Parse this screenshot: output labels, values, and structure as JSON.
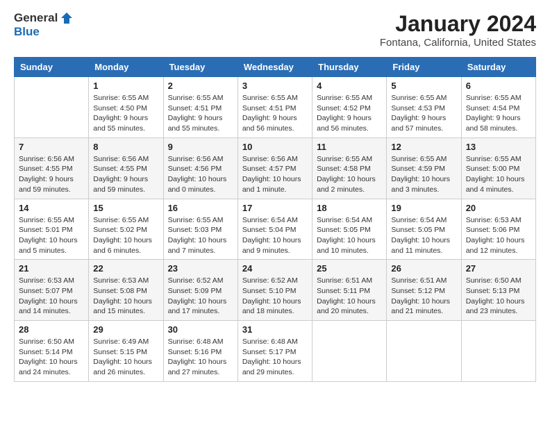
{
  "header": {
    "logo_general": "General",
    "logo_blue": "Blue",
    "title": "January 2024",
    "subtitle": "Fontana, California, United States"
  },
  "days_of_week": [
    "Sunday",
    "Monday",
    "Tuesday",
    "Wednesday",
    "Thursday",
    "Friday",
    "Saturday"
  ],
  "weeks": [
    [
      {
        "day": "",
        "info": ""
      },
      {
        "day": "1",
        "info": "Sunrise: 6:55 AM\nSunset: 4:50 PM\nDaylight: 9 hours\nand 55 minutes."
      },
      {
        "day": "2",
        "info": "Sunrise: 6:55 AM\nSunset: 4:51 PM\nDaylight: 9 hours\nand 55 minutes."
      },
      {
        "day": "3",
        "info": "Sunrise: 6:55 AM\nSunset: 4:51 PM\nDaylight: 9 hours\nand 56 minutes."
      },
      {
        "day": "4",
        "info": "Sunrise: 6:55 AM\nSunset: 4:52 PM\nDaylight: 9 hours\nand 56 minutes."
      },
      {
        "day": "5",
        "info": "Sunrise: 6:55 AM\nSunset: 4:53 PM\nDaylight: 9 hours\nand 57 minutes."
      },
      {
        "day": "6",
        "info": "Sunrise: 6:55 AM\nSunset: 4:54 PM\nDaylight: 9 hours\nand 58 minutes."
      }
    ],
    [
      {
        "day": "7",
        "info": "Sunrise: 6:56 AM\nSunset: 4:55 PM\nDaylight: 9 hours\nand 59 minutes."
      },
      {
        "day": "8",
        "info": "Sunrise: 6:56 AM\nSunset: 4:55 PM\nDaylight: 9 hours\nand 59 minutes."
      },
      {
        "day": "9",
        "info": "Sunrise: 6:56 AM\nSunset: 4:56 PM\nDaylight: 10 hours\nand 0 minutes."
      },
      {
        "day": "10",
        "info": "Sunrise: 6:56 AM\nSunset: 4:57 PM\nDaylight: 10 hours\nand 1 minute."
      },
      {
        "day": "11",
        "info": "Sunrise: 6:55 AM\nSunset: 4:58 PM\nDaylight: 10 hours\nand 2 minutes."
      },
      {
        "day": "12",
        "info": "Sunrise: 6:55 AM\nSunset: 4:59 PM\nDaylight: 10 hours\nand 3 minutes."
      },
      {
        "day": "13",
        "info": "Sunrise: 6:55 AM\nSunset: 5:00 PM\nDaylight: 10 hours\nand 4 minutes."
      }
    ],
    [
      {
        "day": "14",
        "info": "Sunrise: 6:55 AM\nSunset: 5:01 PM\nDaylight: 10 hours\nand 5 minutes."
      },
      {
        "day": "15",
        "info": "Sunrise: 6:55 AM\nSunset: 5:02 PM\nDaylight: 10 hours\nand 6 minutes."
      },
      {
        "day": "16",
        "info": "Sunrise: 6:55 AM\nSunset: 5:03 PM\nDaylight: 10 hours\nand 7 minutes."
      },
      {
        "day": "17",
        "info": "Sunrise: 6:54 AM\nSunset: 5:04 PM\nDaylight: 10 hours\nand 9 minutes."
      },
      {
        "day": "18",
        "info": "Sunrise: 6:54 AM\nSunset: 5:05 PM\nDaylight: 10 hours\nand 10 minutes."
      },
      {
        "day": "19",
        "info": "Sunrise: 6:54 AM\nSunset: 5:05 PM\nDaylight: 10 hours\nand 11 minutes."
      },
      {
        "day": "20",
        "info": "Sunrise: 6:53 AM\nSunset: 5:06 PM\nDaylight: 10 hours\nand 12 minutes."
      }
    ],
    [
      {
        "day": "21",
        "info": "Sunrise: 6:53 AM\nSunset: 5:07 PM\nDaylight: 10 hours\nand 14 minutes."
      },
      {
        "day": "22",
        "info": "Sunrise: 6:53 AM\nSunset: 5:08 PM\nDaylight: 10 hours\nand 15 minutes."
      },
      {
        "day": "23",
        "info": "Sunrise: 6:52 AM\nSunset: 5:09 PM\nDaylight: 10 hours\nand 17 minutes."
      },
      {
        "day": "24",
        "info": "Sunrise: 6:52 AM\nSunset: 5:10 PM\nDaylight: 10 hours\nand 18 minutes."
      },
      {
        "day": "25",
        "info": "Sunrise: 6:51 AM\nSunset: 5:11 PM\nDaylight: 10 hours\nand 20 minutes."
      },
      {
        "day": "26",
        "info": "Sunrise: 6:51 AM\nSunset: 5:12 PM\nDaylight: 10 hours\nand 21 minutes."
      },
      {
        "day": "27",
        "info": "Sunrise: 6:50 AM\nSunset: 5:13 PM\nDaylight: 10 hours\nand 23 minutes."
      }
    ],
    [
      {
        "day": "28",
        "info": "Sunrise: 6:50 AM\nSunset: 5:14 PM\nDaylight: 10 hours\nand 24 minutes."
      },
      {
        "day": "29",
        "info": "Sunrise: 6:49 AM\nSunset: 5:15 PM\nDaylight: 10 hours\nand 26 minutes."
      },
      {
        "day": "30",
        "info": "Sunrise: 6:48 AM\nSunset: 5:16 PM\nDaylight: 10 hours\nand 27 minutes."
      },
      {
        "day": "31",
        "info": "Sunrise: 6:48 AM\nSunset: 5:17 PM\nDaylight: 10 hours\nand 29 minutes."
      },
      {
        "day": "",
        "info": ""
      },
      {
        "day": "",
        "info": ""
      },
      {
        "day": "",
        "info": ""
      }
    ]
  ]
}
